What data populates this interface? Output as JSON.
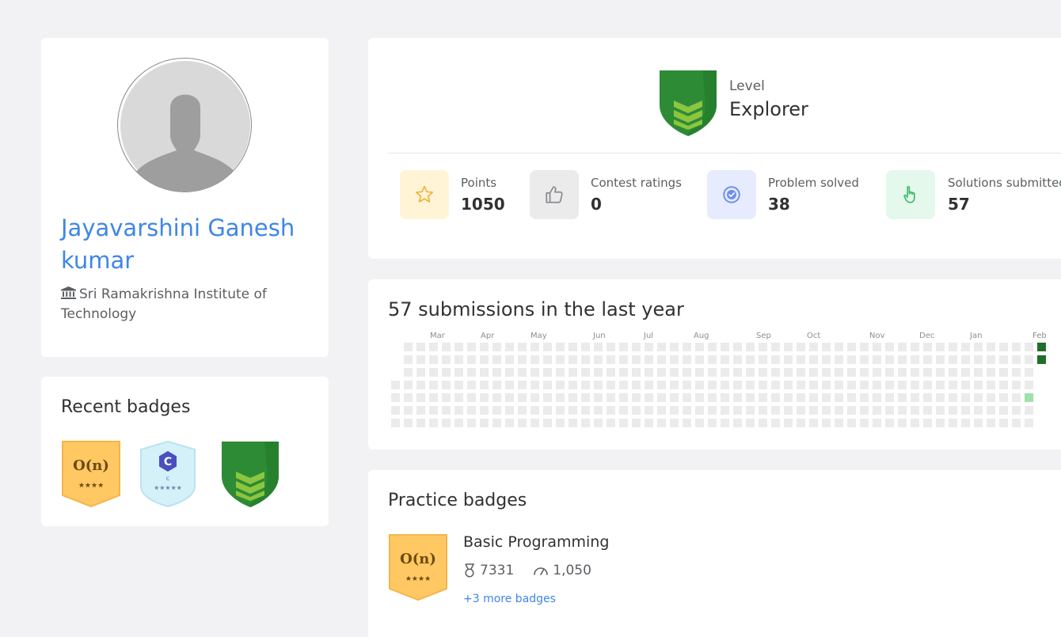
{
  "profile": {
    "name": "Jayavarshini Ganesh kumar",
    "college": "Sri Ramakrishna Institute of Technology"
  },
  "recent_badges": {
    "title": "Recent badges",
    "items": [
      {
        "icon": "big-o-badge-icon",
        "text": "O(n)",
        "stars": "★★★★",
        "color": "#ffc862"
      },
      {
        "icon": "c-language-badge-icon",
        "text": "C",
        "stars": "★★★★★",
        "color": "#d4f0f9"
      },
      {
        "icon": "level-shield-icon",
        "color": "#2e8b35"
      }
    ]
  },
  "level": {
    "caption": "Level",
    "value": "Explorer"
  },
  "stats": [
    {
      "icon": "star-icon",
      "label": "Points",
      "value": "1050",
      "bg": "#fff4d6",
      "fg": "#f2b33d"
    },
    {
      "icon": "thumbs-up-icon",
      "label": "Contest ratings",
      "value": "0",
      "bg": "#ebebec",
      "fg": "#8a8c90"
    },
    {
      "icon": "check-circle-icon",
      "label": "Problem solved",
      "value": "38",
      "bg": "#e6ecfd",
      "fg": "#6c8ff0"
    },
    {
      "icon": "pointer-hand-icon",
      "label": "Solutions submitted",
      "value": "57",
      "bg": "#e4f8ec",
      "fg": "#3cb96a"
    }
  ],
  "submissions": {
    "title": "57 submissions in the last year",
    "months": [
      "Mar",
      "Apr",
      "May",
      "Jun",
      "Jul",
      "Aug",
      "Sep",
      "Oct",
      "Nov",
      "Dec",
      "Jan",
      "Feb"
    ],
    "colors": {
      "empty": "#ebebeb",
      "low": "#9fe0a5",
      "high": "#1f6f2b"
    }
  },
  "practice": {
    "title": "Practice badges",
    "badge": {
      "icon": "big-o-badge-icon",
      "text": "O(n)",
      "stars": "★★★★"
    },
    "name": "Basic Programming",
    "rank": "7331",
    "score": "1,050",
    "more": "+3 more badges"
  }
}
